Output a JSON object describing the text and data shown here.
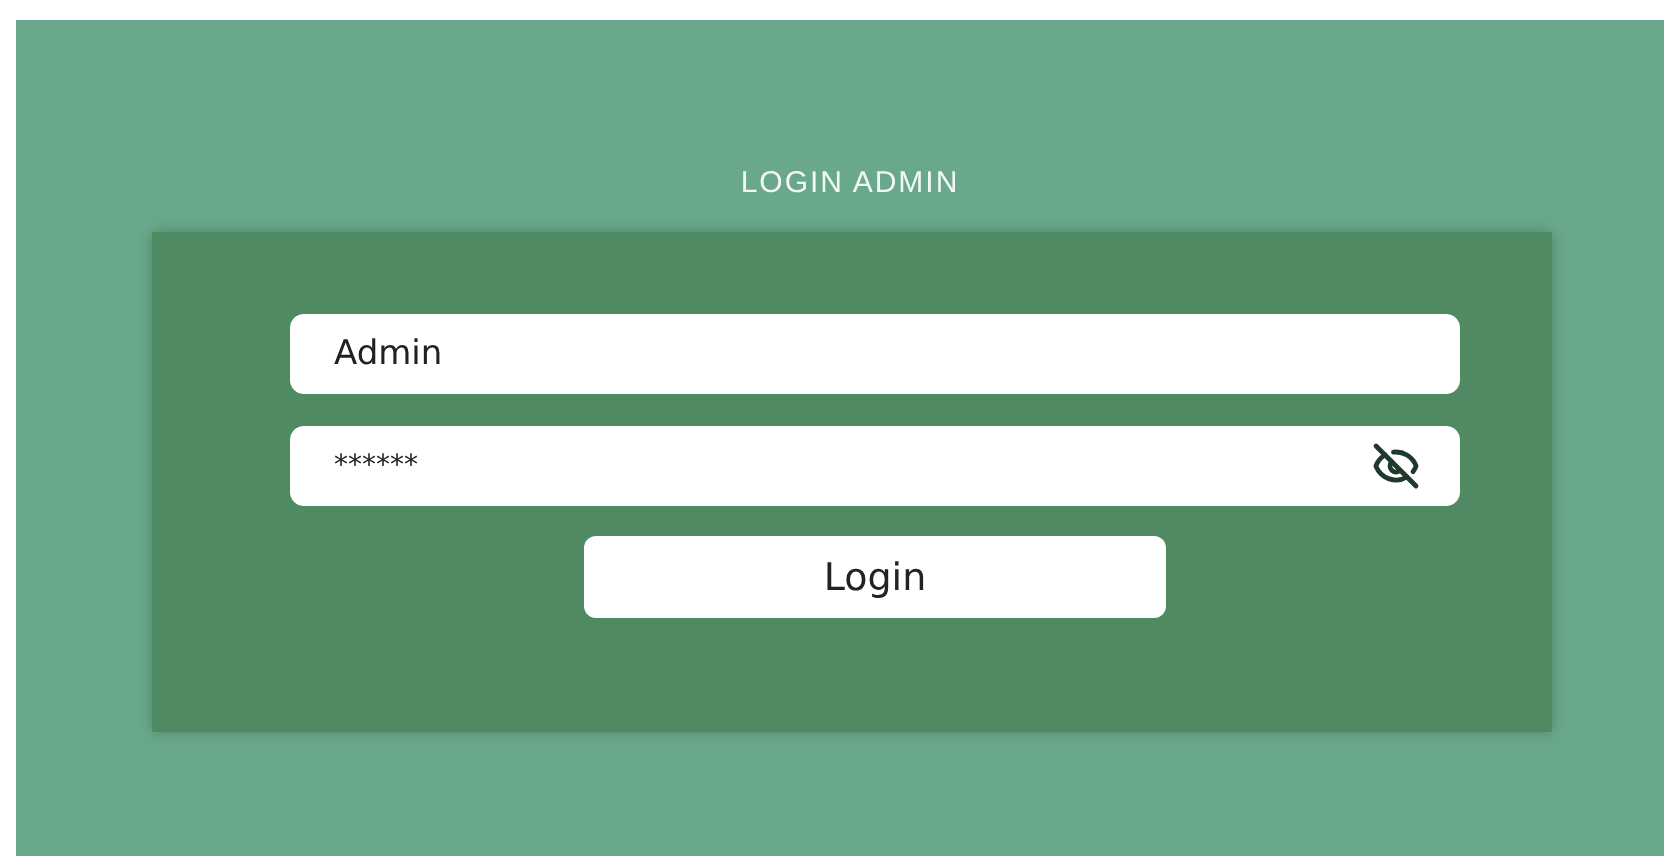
{
  "title": "LOGIN ADMIN",
  "username": {
    "value": "Admin"
  },
  "password": {
    "value": "******"
  },
  "login_button": {
    "label": "Login"
  }
}
